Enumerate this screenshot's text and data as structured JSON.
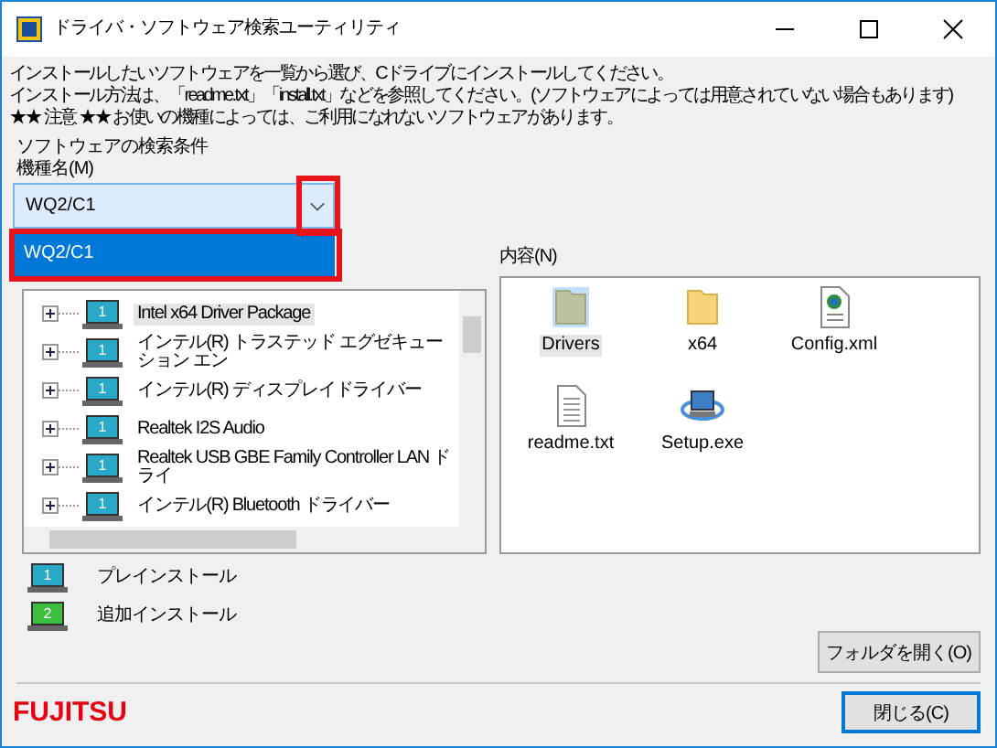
{
  "window": {
    "title": "ドライバ・ソフトウェア検索ユーティリティ"
  },
  "instructions": [
    "インストールしたいソフトウェアを一覧から選び、Cドライブにインストールしてください。",
    "インストール方法は、「readme.txt」「install.txt」などを参照してください。(ソフトウェアによっては用意されていない場合もあります)",
    "★★ 注意 ★★ お使いの機種によっては、ご利用になれないソフトウェアがあります。"
  ],
  "search_conditions": {
    "heading": "ソフトウェアの検索条件",
    "model_label": "機種名(M)",
    "model_value": "WQ2/C1",
    "arrow_annotated": true,
    "options": [
      {
        "label": "WQ2/C1",
        "selected": true,
        "annotated": true
      }
    ]
  },
  "software_tree": {
    "items": [
      {
        "label": "Intel x64 Driver Package",
        "badge": "1",
        "selected": true
      },
      {
        "label": "インテル(R) トラステッド エグゼキューション エン",
        "badge": "1",
        "selected": false
      },
      {
        "label": "インテル(R) ディスプレイドライバー",
        "badge": "1",
        "selected": false
      },
      {
        "label": "Realtek I2S Audio",
        "badge": "1",
        "selected": false
      },
      {
        "label": "Realtek USB GBE Family Controller LAN ドライ",
        "badge": "1",
        "selected": false
      },
      {
        "label": "インテル(R) Bluetooth ドライバー",
        "badge": "1",
        "selected": false
      }
    ]
  },
  "contents": {
    "label": "内容(N)",
    "files": [
      {
        "name": "Drivers",
        "kind": "folder",
        "selected": true
      },
      {
        "name": "x64",
        "kind": "folder",
        "selected": false
      },
      {
        "name": "Config.xml",
        "kind": "xml",
        "selected": false
      },
      {
        "name": "readme.txt",
        "kind": "text",
        "selected": false
      },
      {
        "name": "Setup.exe",
        "kind": "exe",
        "selected": false
      }
    ]
  },
  "legend": [
    {
      "label": "プレインストール",
      "badge": "1",
      "color": "#2aa8c8"
    },
    {
      "label": "追加インストール",
      "badge": "2",
      "color": "#3cbf3c"
    }
  ],
  "buttons": {
    "open_folder": "フォルダを開く(O)",
    "close": "閉じる(C)"
  },
  "logo": "FUJITSU"
}
